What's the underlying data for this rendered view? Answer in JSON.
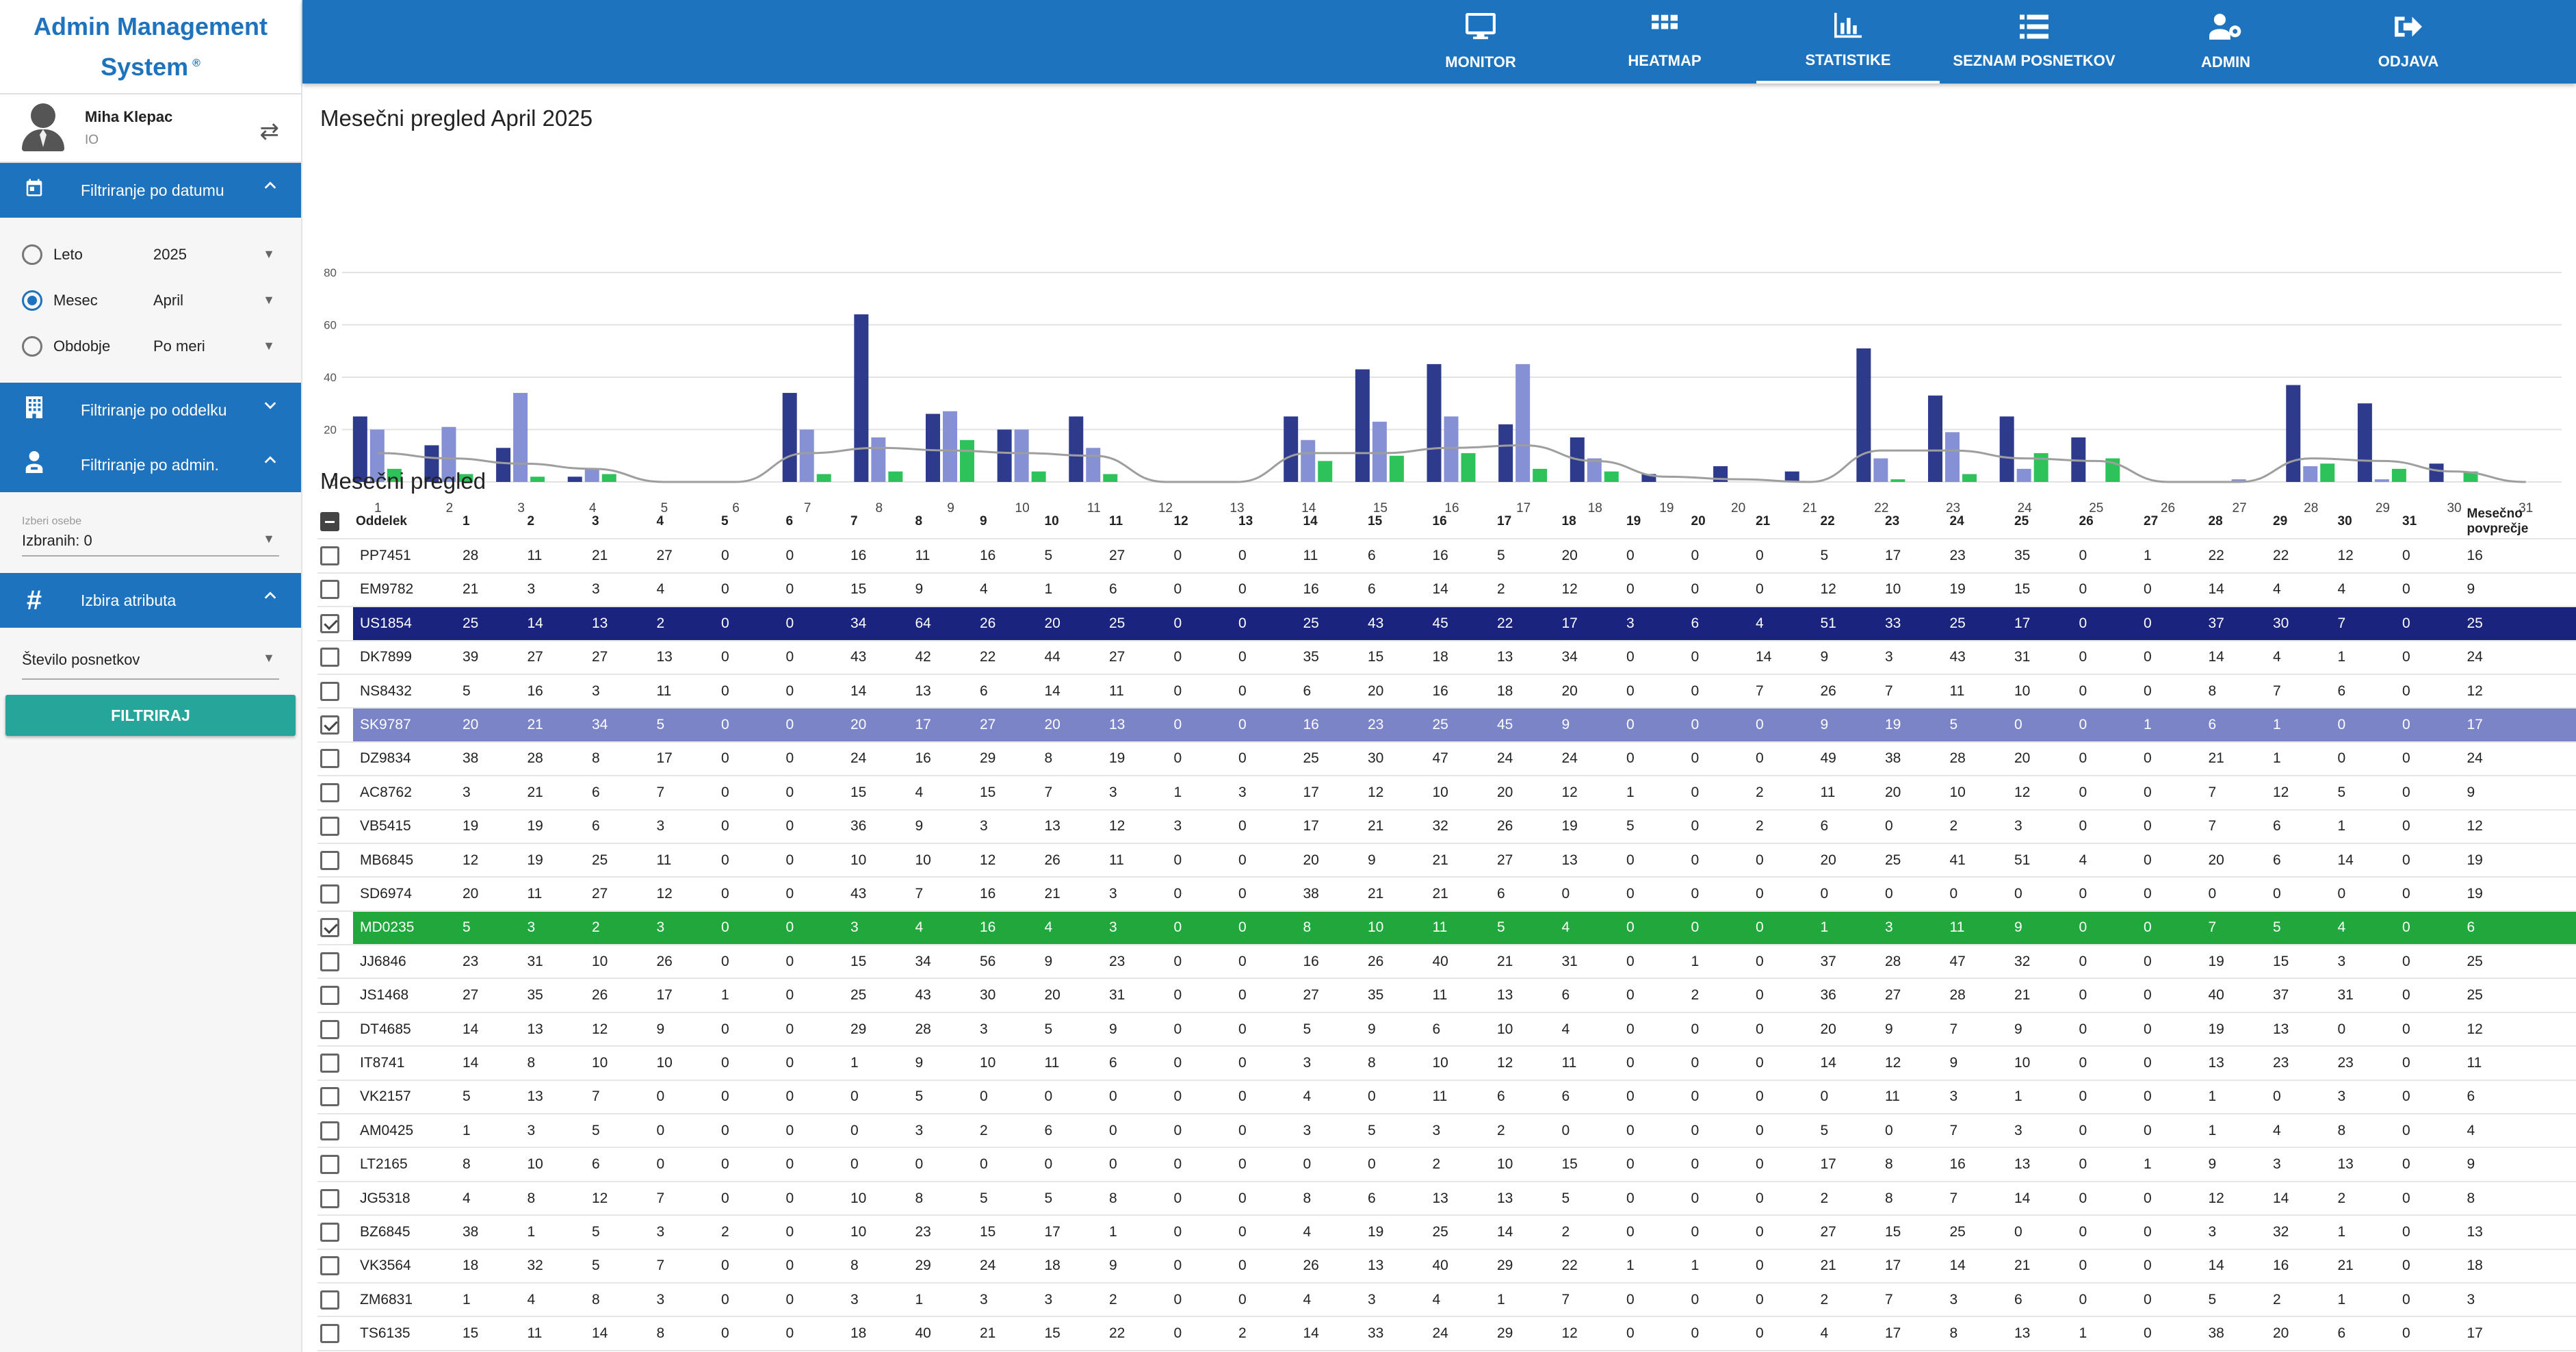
{
  "brand": {
    "line1": "Admin Management",
    "line2": "System",
    "mark": "®"
  },
  "user": {
    "name": "Miha Klepac",
    "role": "IO",
    "swap_icon": "⇄"
  },
  "filters": {
    "date": {
      "label": "Filtriranje po datumu",
      "options": [
        {
          "label": "Leto",
          "value": "2025",
          "selected": false
        },
        {
          "label": "Mesec",
          "value": "April",
          "selected": true
        },
        {
          "label": "Obdobje",
          "value": "Po meri",
          "selected": false
        }
      ]
    },
    "department": {
      "label": "Filtriranje po oddelku"
    },
    "admin": {
      "label": "Filtriranje po admin.",
      "select_label": "Izberi osebe",
      "select_value": "Izbranih: 0"
    },
    "attribute": {
      "label": "Izbira atributa",
      "value": "Število posnetkov"
    },
    "button": "FILTRIRAJ"
  },
  "nav": [
    {
      "label": "MONITOR",
      "icon": "monitor-icon"
    },
    {
      "label": "HEATMAP",
      "icon": "grid-icon"
    },
    {
      "label": "STATISTIKE",
      "icon": "bar-chart-icon",
      "active": true
    },
    {
      "label": "SEZNAM POSNETKOV",
      "icon": "list-icon"
    },
    {
      "label": "ADMIN",
      "icon": "user-gear-icon"
    },
    {
      "label": "ODJAVA",
      "icon": "logout-icon"
    }
  ],
  "chart_title": "Mesečni pregled April 2025",
  "table_title": "Mesečni pregled",
  "chart_data": {
    "type": "bar",
    "categories": [
      "1",
      "2",
      "3",
      "4",
      "5",
      "6",
      "7",
      "8",
      "9",
      "10",
      "11",
      "12",
      "13",
      "14",
      "15",
      "16",
      "17",
      "18",
      "19",
      "20",
      "21",
      "22",
      "23",
      "24",
      "25",
      "26",
      "27",
      "28",
      "29",
      "30",
      "31"
    ],
    "ylim": [
      0,
      80
    ],
    "yticks": [
      0,
      20,
      40,
      60,
      80
    ],
    "series": [
      {
        "color": "#2e3a8c",
        "values": [
          25,
          14,
          13,
          2,
          0,
          0,
          34,
          64,
          26,
          20,
          25,
          0,
          0,
          25,
          43,
          45,
          22,
          17,
          3,
          6,
          4,
          51,
          33,
          25,
          17,
          0,
          0,
          37,
          30,
          7,
          0
        ]
      },
      {
        "color": "#8591d4",
        "values": [
          20,
          21,
          34,
          5,
          0,
          0,
          20,
          17,
          27,
          20,
          13,
          0,
          0,
          16,
          23,
          25,
          45,
          9,
          0,
          0,
          0,
          9,
          19,
          5,
          0,
          0,
          1,
          6,
          1,
          0,
          0
        ]
      },
      {
        "color": "#2ec35a",
        "values": [
          5,
          3,
          2,
          3,
          0,
          0,
          3,
          4,
          16,
          4,
          3,
          0,
          0,
          8,
          10,
          11,
          5,
          4,
          0,
          0,
          0,
          1,
          3,
          11,
          9,
          0,
          0,
          7,
          5,
          4,
          0
        ]
      },
      {
        "color": "#9e9e9e",
        "line": true,
        "values": [
          11,
          9,
          7,
          5,
          0,
          0,
          11,
          13,
          12,
          11,
          10,
          0,
          0,
          11,
          11,
          13,
          14,
          8,
          2,
          1,
          0,
          12,
          12,
          9,
          8,
          0,
          0,
          9,
          8,
          4,
          0
        ]
      }
    ]
  },
  "table": {
    "headers": [
      "Oddelek",
      "1",
      "2",
      "3",
      "4",
      "5",
      "6",
      "7",
      "8",
      "9",
      "10",
      "11",
      "12",
      "13",
      "14",
      "15",
      "16",
      "17",
      "18",
      "19",
      "20",
      "21",
      "22",
      "23",
      "24",
      "25",
      "26",
      "27",
      "28",
      "29",
      "30",
      "31",
      "Mesečno povprečje"
    ],
    "rows": [
      {
        "name": "PP7451",
        "v": [
          28,
          11,
          21,
          27,
          0,
          0,
          16,
          11,
          16,
          5,
          27,
          0,
          0,
          11,
          6,
          16,
          5,
          20,
          0,
          0,
          0,
          5,
          17,
          23,
          35,
          0,
          1,
          22,
          22,
          12,
          0
        ],
        "avg": 16
      },
      {
        "name": "EM9782",
        "v": [
          21,
          3,
          3,
          4,
          0,
          0,
          15,
          9,
          4,
          1,
          6,
          0,
          0,
          16,
          6,
          14,
          2,
          12,
          0,
          0,
          0,
          12,
          10,
          19,
          15,
          0,
          0,
          14,
          4,
          4,
          0
        ],
        "avg": 9
      },
      {
        "name": "US1854",
        "v": [
          25,
          14,
          13,
          2,
          0,
          0,
          34,
          64,
          26,
          20,
          25,
          0,
          0,
          25,
          43,
          45,
          22,
          17,
          3,
          6,
          4,
          51,
          33,
          25,
          17,
          0,
          0,
          37,
          30,
          7,
          0
        ],
        "avg": 25,
        "selected": true,
        "color": "#1a237e"
      },
      {
        "name": "DK7899",
        "v": [
          39,
          27,
          27,
          13,
          0,
          0,
          43,
          42,
          22,
          44,
          27,
          0,
          0,
          35,
          15,
          18,
          13,
          34,
          0,
          0,
          14,
          9,
          3,
          43,
          31,
          0,
          0,
          14,
          4,
          1,
          0
        ],
        "avg": 24
      },
      {
        "name": "NS8432",
        "v": [
          5,
          16,
          3,
          11,
          0,
          0,
          14,
          13,
          6,
          14,
          11,
          0,
          0,
          6,
          20,
          16,
          18,
          20,
          0,
          0,
          7,
          26,
          7,
          11,
          10,
          0,
          0,
          8,
          7,
          6,
          0
        ],
        "avg": 12
      },
      {
        "name": "SK9787",
        "v": [
          20,
          21,
          34,
          5,
          0,
          0,
          20,
          17,
          27,
          20,
          13,
          0,
          0,
          16,
          23,
          25,
          45,
          9,
          0,
          0,
          0,
          9,
          19,
          5,
          0,
          0,
          1,
          6,
          1,
          0,
          0
        ],
        "avg": 17,
        "selected": true,
        "color": "#7a84c6"
      },
      {
        "name": "DZ9834",
        "v": [
          38,
          28,
          8,
          17,
          0,
          0,
          24,
          16,
          29,
          8,
          19,
          0,
          0,
          25,
          30,
          47,
          24,
          24,
          0,
          0,
          0,
          49,
          38,
          28,
          20,
          0,
          0,
          21,
          1,
          0,
          0
        ],
        "avg": 24
      },
      {
        "name": "AC8762",
        "v": [
          3,
          21,
          6,
          7,
          0,
          0,
          15,
          4,
          15,
          7,
          3,
          1,
          3,
          17,
          12,
          10,
          20,
          12,
          1,
          0,
          2,
          11,
          20,
          10,
          12,
          0,
          0,
          7,
          12,
          5,
          0
        ],
        "avg": 9
      },
      {
        "name": "VB5415",
        "v": [
          19,
          19,
          6,
          3,
          0,
          0,
          36,
          9,
          3,
          13,
          12,
          3,
          0,
          17,
          21,
          32,
          26,
          19,
          5,
          0,
          2,
          6,
          0,
          2,
          3,
          0,
          0,
          7,
          6,
          1,
          0
        ],
        "avg": 12
      },
      {
        "name": "MB6845",
        "v": [
          12,
          19,
          25,
          11,
          0,
          0,
          10,
          10,
          12,
          26,
          11,
          0,
          0,
          20,
          9,
          21,
          27,
          13,
          0,
          0,
          0,
          20,
          25,
          41,
          51,
          4,
          0,
          20,
          6,
          14,
          0
        ],
        "avg": 19
      },
      {
        "name": "SD6974",
        "v": [
          20,
          11,
          27,
          12,
          0,
          0,
          43,
          7,
          16,
          21,
          3,
          0,
          0,
          38,
          21,
          21,
          6,
          0,
          0,
          0,
          0,
          0,
          0,
          0,
          0,
          0,
          0,
          0,
          0,
          0,
          0
        ],
        "avg": 19
      },
      {
        "name": "MD0235",
        "v": [
          5,
          3,
          2,
          3,
          0,
          0,
          3,
          4,
          16,
          4,
          3,
          0,
          0,
          8,
          10,
          11,
          5,
          4,
          0,
          0,
          0,
          1,
          3,
          11,
          9,
          0,
          0,
          7,
          5,
          4,
          0
        ],
        "avg": 6,
        "selected": true,
        "color": "#21a83c"
      },
      {
        "name": "JJ6846",
        "v": [
          23,
          31,
          10,
          26,
          0,
          0,
          15,
          34,
          56,
          9,
          23,
          0,
          0,
          16,
          26,
          40,
          21,
          31,
          0,
          1,
          0,
          37,
          28,
          47,
          32,
          0,
          0,
          19,
          15,
          3,
          0
        ],
        "avg": 25
      },
      {
        "name": "JS1468",
        "v": [
          27,
          35,
          26,
          17,
          1,
          0,
          25,
          43,
          30,
          20,
          31,
          0,
          0,
          27,
          35,
          11,
          13,
          6,
          0,
          2,
          0,
          36,
          27,
          28,
          21,
          0,
          0,
          40,
          37,
          31,
          0
        ],
        "avg": 25
      },
      {
        "name": "DT4685",
        "v": [
          14,
          13,
          12,
          9,
          0,
          0,
          29,
          28,
          3,
          5,
          9,
          0,
          0,
          5,
          9,
          6,
          10,
          4,
          0,
          0,
          0,
          20,
          9,
          7,
          9,
          0,
          0,
          19,
          13,
          0,
          0
        ],
        "avg": 12
      },
      {
        "name": "IT8741",
        "v": [
          14,
          8,
          10,
          10,
          0,
          0,
          1,
          9,
          10,
          11,
          6,
          0,
          0,
          3,
          8,
          10,
          12,
          11,
          0,
          0,
          0,
          14,
          12,
          9,
          10,
          0,
          0,
          13,
          23,
          23,
          0
        ],
        "avg": 11
      },
      {
        "name": "VK2157",
        "v": [
          5,
          13,
          7,
          0,
          0,
          0,
          0,
          5,
          0,
          0,
          0,
          0,
          0,
          4,
          0,
          11,
          6,
          6,
          0,
          0,
          0,
          0,
          11,
          3,
          1,
          0,
          0,
          1,
          0,
          3,
          0
        ],
        "avg": 6
      },
      {
        "name": "AM0425",
        "v": [
          1,
          3,
          5,
          0,
          0,
          0,
          0,
          3,
          2,
          6,
          0,
          0,
          0,
          3,
          5,
          3,
          2,
          0,
          0,
          0,
          0,
          5,
          0,
          7,
          3,
          0,
          0,
          1,
          4,
          8,
          0
        ],
        "avg": 4
      },
      {
        "name": "LT2165",
        "v": [
          8,
          10,
          6,
          0,
          0,
          0,
          0,
          0,
          0,
          0,
          0,
          0,
          0,
          0,
          0,
          2,
          10,
          15,
          0,
          0,
          0,
          17,
          8,
          16,
          13,
          0,
          1,
          9,
          3,
          13,
          0
        ],
        "avg": 9
      },
      {
        "name": "JG5318",
        "v": [
          4,
          8,
          12,
          7,
          0,
          0,
          10,
          8,
          5,
          5,
          8,
          0,
          0,
          8,
          6,
          13,
          13,
          5,
          0,
          0,
          0,
          2,
          8,
          7,
          14,
          0,
          0,
          12,
          14,
          2,
          0
        ],
        "avg": 8
      },
      {
        "name": "BZ6845",
        "v": [
          38,
          1,
          5,
          3,
          2,
          0,
          10,
          23,
          15,
          17,
          1,
          0,
          0,
          4,
          19,
          25,
          14,
          2,
          0,
          0,
          0,
          27,
          15,
          25,
          0,
          0,
          0,
          3,
          32,
          1,
          0
        ],
        "avg": 13
      },
      {
        "name": "VK3564",
        "v": [
          18,
          32,
          5,
          7,
          0,
          0,
          8,
          29,
          24,
          18,
          9,
          0,
          0,
          26,
          13,
          40,
          29,
          22,
          1,
          1,
          0,
          21,
          17,
          14,
          21,
          0,
          0,
          14,
          16,
          21,
          0
        ],
        "avg": 18
      },
      {
        "name": "ZM6831",
        "v": [
          1,
          4,
          8,
          3,
          0,
          0,
          3,
          1,
          3,
          3,
          2,
          0,
          0,
          4,
          3,
          4,
          1,
          7,
          0,
          0,
          0,
          2,
          7,
          3,
          6,
          0,
          0,
          5,
          2,
          1,
          0
        ],
        "avg": 3
      },
      {
        "name": "TS6135",
        "v": [
          15,
          11,
          14,
          8,
          0,
          0,
          18,
          40,
          21,
          15,
          22,
          0,
          2,
          14,
          33,
          24,
          29,
          12,
          0,
          0,
          0,
          4,
          17,
          8,
          13,
          1,
          0,
          38,
          20,
          6,
          0
        ],
        "avg": 17
      }
    ]
  }
}
